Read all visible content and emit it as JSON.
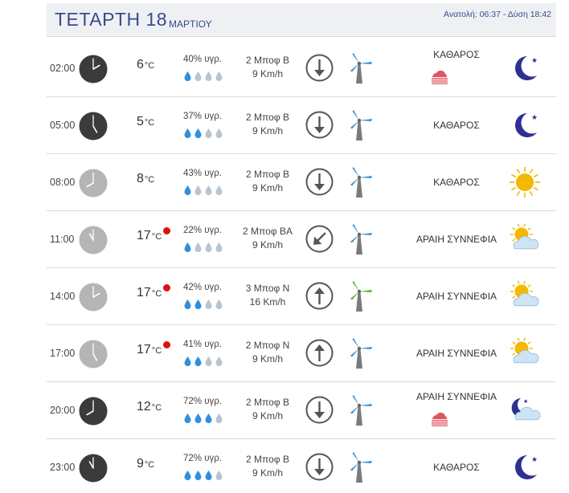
{
  "header": {
    "day": "ΤΕΤΑΡΤΗ 18",
    "month": "ΜΑΡΤΙΟΥ",
    "sun": "Ανατολή: 06:37  - Δύση 18:42"
  },
  "temp_unit": "°C",
  "rows": [
    {
      "time": "02:00",
      "clock": "dark",
      "hour": 2,
      "temp": "6",
      "heat": false,
      "humidity": "40% υγρ.",
      "drops": 1,
      "wind_bf": "2 Μποφ Β",
      "wind_kmh": "9 Km/h",
      "wind_dir_deg": 0,
      "wind_strong": false,
      "condition": "ΚΑΘΑΡΟΣ",
      "rain_icon": true,
      "weather_icon": "moon-icon"
    },
    {
      "time": "05:00",
      "clock": "dark",
      "hour": 5,
      "temp": "5",
      "heat": false,
      "humidity": "37% υγρ.",
      "drops": 2,
      "wind_bf": "2 Μποφ Β",
      "wind_kmh": "9 Km/h",
      "wind_dir_deg": 0,
      "wind_strong": false,
      "condition": "ΚΑΘΑΡΟΣ",
      "rain_icon": false,
      "weather_icon": "moon-icon"
    },
    {
      "time": "08:00",
      "clock": "light",
      "hour": 8,
      "temp": "8",
      "heat": false,
      "humidity": "43% υγρ.",
      "drops": 1,
      "wind_bf": "2 Μποφ Β",
      "wind_kmh": "9 Km/h",
      "wind_dir_deg": 0,
      "wind_strong": false,
      "condition": "ΚΑΘΑΡΟΣ",
      "rain_icon": false,
      "weather_icon": "sun-icon"
    },
    {
      "time": "11:00",
      "clock": "light",
      "hour": 11,
      "temp": "17",
      "heat": true,
      "humidity": "22% υγρ.",
      "drops": 1,
      "wind_bf": "2 Μποφ ΒΑ",
      "wind_kmh": "9 Km/h",
      "wind_dir_deg": 45,
      "wind_strong": false,
      "condition": "ΑΡΑΙΗ ΣΥΝΝΕΦΙΑ",
      "rain_icon": false,
      "weather_icon": "partly-cloudy-day-icon"
    },
    {
      "time": "14:00",
      "clock": "light",
      "hour": 2,
      "temp": "17",
      "heat": true,
      "humidity": "42% υγρ.",
      "drops": 2,
      "wind_bf": "3 Μποφ Ν",
      "wind_kmh": "16 Km/h",
      "wind_dir_deg": 180,
      "wind_strong": true,
      "condition": "ΑΡΑΙΗ ΣΥΝΝΕΦΙΑ",
      "rain_icon": false,
      "weather_icon": "partly-cloudy-day-icon"
    },
    {
      "time": "17:00",
      "clock": "light",
      "hour": 5,
      "temp": "17",
      "heat": true,
      "humidity": "41% υγρ.",
      "drops": 2,
      "wind_bf": "2 Μποφ Ν",
      "wind_kmh": "9 Km/h",
      "wind_dir_deg": 180,
      "wind_strong": false,
      "condition": "ΑΡΑΙΗ ΣΥΝΝΕΦΙΑ",
      "rain_icon": false,
      "weather_icon": "partly-cloudy-day-icon"
    },
    {
      "time": "20:00",
      "clock": "dark",
      "hour": 8,
      "temp": "12",
      "heat": false,
      "humidity": "72% υγρ.",
      "drops": 3,
      "wind_bf": "2 Μποφ Β",
      "wind_kmh": "9 Km/h",
      "wind_dir_deg": 0,
      "wind_strong": false,
      "condition": "ΑΡΑΙΗ ΣΥΝΝΕΦΙΑ",
      "rain_icon": true,
      "weather_icon": "partly-cloudy-night-icon"
    },
    {
      "time": "23:00",
      "clock": "dark",
      "hour": 11,
      "temp": "9",
      "heat": false,
      "humidity": "72% υγρ.",
      "drops": 3,
      "wind_bf": "2 Μποφ Β",
      "wind_kmh": "9 Km/h",
      "wind_dir_deg": 0,
      "wind_strong": false,
      "condition": "ΚΑΘΑΡΟΣ",
      "rain_icon": false,
      "weather_icon": "moon-icon"
    }
  ],
  "colors": {
    "title": "#3a4a8c",
    "clock_dark": "#3b3b3b",
    "clock_light": "#b5b5b5",
    "drop_full": "#2f8fdd",
    "drop_empty": "#b9c4cf",
    "turbine_blade": "#3a8fd0",
    "turbine_blade_strong": "#5cae2e",
    "heat_dot": "#e01010",
    "moon": "#2e3192",
    "sun": "#f5b800",
    "rain": "#e0555f"
  }
}
